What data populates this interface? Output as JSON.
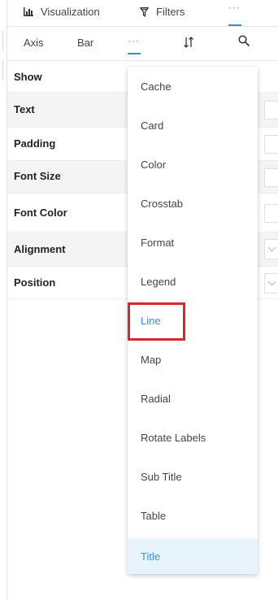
{
  "top_tabs": {
    "visualization_label": "Visualization",
    "filters_label": "Filters",
    "more_label": "···"
  },
  "sub_tabs": {
    "axis_label": "Axis",
    "bar_label": "Bar",
    "more_label": "···"
  },
  "properties": [
    {
      "label": "Show"
    },
    {
      "label": "Text"
    },
    {
      "label": "Padding"
    },
    {
      "label": "Font Size"
    },
    {
      "label": "Font Color"
    },
    {
      "label": "Alignment"
    },
    {
      "label": "Position"
    }
  ],
  "dropdown": {
    "items": [
      {
        "label": "Cache"
      },
      {
        "label": "Card"
      },
      {
        "label": "Color"
      },
      {
        "label": "Crosstab"
      },
      {
        "label": "Format"
      },
      {
        "label": "Legend"
      },
      {
        "label": "Line"
      },
      {
        "label": "Map"
      },
      {
        "label": "Radial"
      },
      {
        "label": "Rotate Labels"
      },
      {
        "label": "Sub Title"
      },
      {
        "label": "Table"
      },
      {
        "label": "Title"
      }
    ],
    "highlighted_item": "Line",
    "selected_item": "Title"
  },
  "colors": {
    "accent": "#3a8fd8",
    "highlight_border": "#d9262c",
    "selected_bg": "#e8f4fb"
  },
  "icons": {
    "visualization": "bar-chart-icon",
    "filters": "filter-icon",
    "sort": "sort-icon",
    "search": "search-icon"
  }
}
